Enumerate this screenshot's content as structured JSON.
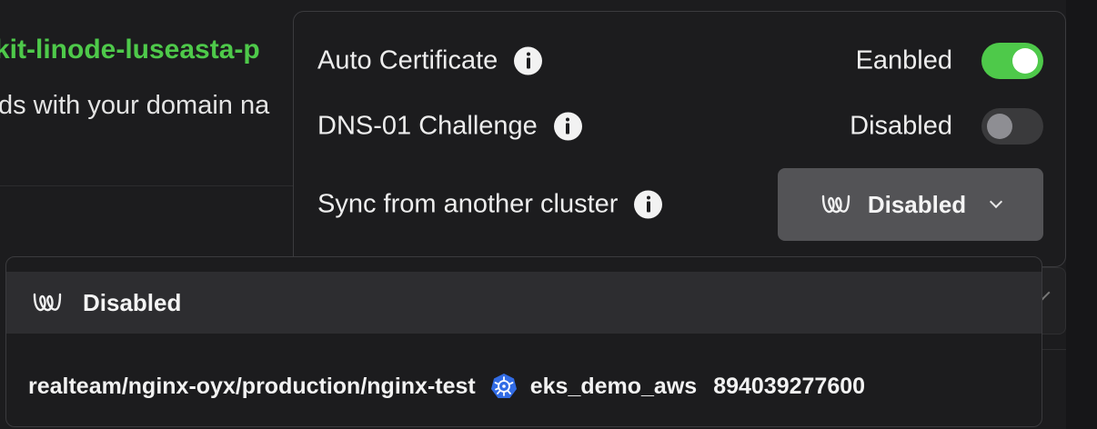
{
  "background": {
    "hostname": "kit-linode-luseasta-p",
    "description": "ds with your domain na"
  },
  "settings": {
    "auto_certificate": {
      "label": "Auto Certificate",
      "status": "Eanbled",
      "enabled": true
    },
    "dns01_challenge": {
      "label": "DNS-01 Challenge",
      "status": "Disabled",
      "enabled": false
    },
    "sync_cluster": {
      "label": "Sync from another cluster",
      "selected": "Disabled"
    }
  },
  "dropdown": {
    "options": [
      {
        "label": "Disabled",
        "icon": "wl-logo-icon"
      },
      {
        "path": "realteam/nginx-oyx/production/nginx-test",
        "icon": "kubernetes-icon",
        "cluster_name": "eks_demo_aws",
        "cluster_id": "894039277600"
      }
    ]
  },
  "colors": {
    "accent_green": "#4ec94a",
    "panel_bg": "#1c1c1e",
    "select_bg": "#535356",
    "k8s_blue": "#326ce5"
  }
}
